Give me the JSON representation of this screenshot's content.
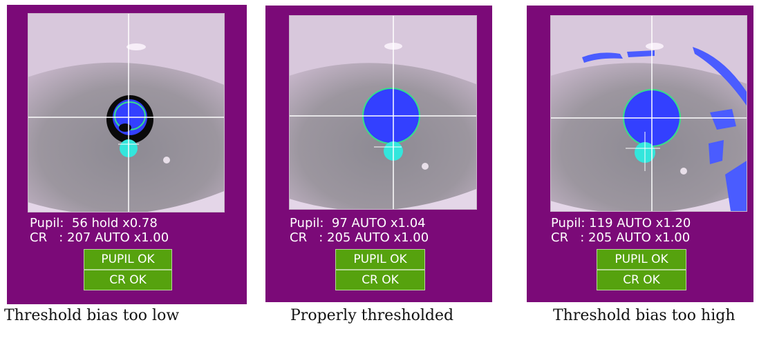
{
  "panels": [
    {
      "pupil_line": "Pupil:  56 hold x0.78",
      "cr_line": "CR   : 207 AUTO x1.00",
      "pupil_button": "PUPIL OK",
      "cr_button": "CR  OK",
      "caption": "Threshold bias too low",
      "state": "too-low"
    },
    {
      "pupil_line": "Pupil:  97 AUTO x1.04",
      "cr_line": "CR   : 205 AUTO x1.00",
      "pupil_button": "PUPIL OK",
      "cr_button": "CR  OK",
      "caption": "Properly thresholded",
      "state": "proper"
    },
    {
      "pupil_line": "Pupil: 119 AUTO x1.20",
      "cr_line": "CR   : 205 AUTO x1.00",
      "pupil_button": "PUPIL OK",
      "cr_button": "CR  OK",
      "caption": "Threshold bias too high",
      "state": "too-high"
    }
  ],
  "colors": {
    "panel_bg": "#7b0a78",
    "button_bg": "#56a20e",
    "pupil_fill": "#3340ff",
    "cr_fill": "#33e6dc",
    "crosshair": "#ffffff",
    "pupil_outline": "#35e08a"
  }
}
